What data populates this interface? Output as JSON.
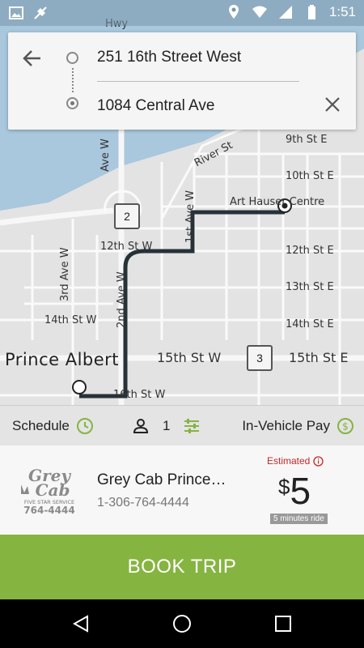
{
  "status_bar": {
    "time": "1:51",
    "icons": [
      "image-icon",
      "no-location-icon",
      "location-icon",
      "wifi-icon",
      "signal-icon",
      "battery-icon"
    ]
  },
  "map": {
    "city_label": "Prince Albert",
    "street_labels": {
      "hwy": "Hwy",
      "ninth": "9th St E",
      "tenth": "10th St E",
      "twelfth_e": "12th St E",
      "thirteenth": "13th St E",
      "fourteenth_e": "14th St E",
      "fifteenth_e": "15th St E",
      "fifteenth_w": "15th St W",
      "twelfth_w": "12th St W",
      "fourteenth_w": "14th St W",
      "sixteenth_w": "16th St W",
      "third_ave": "3rd Ave W",
      "second_ave": "2nd Ave W",
      "first_ave": "1st Ave W",
      "ave_w": "Ave W",
      "river": "River St",
      "poi": "Art Hauser Centre"
    },
    "route_shields": [
      "2",
      "3"
    ]
  },
  "search": {
    "origin": "251 16th Street West",
    "destination": "1084 Central Ave"
  },
  "options": {
    "schedule_label": "Schedule",
    "passenger_count": "1",
    "payment_label": "In-Vehicle Pay"
  },
  "provider": {
    "name": "Grey Cab Prince…",
    "phone": "1-306-764-4444",
    "estimated_label": "Estimated",
    "currency": "$",
    "price": "5",
    "ride_time": "5 minutes ride",
    "logo_text": "Grey Cab FIVE STAR SERVICE 764-4444"
  },
  "book_button": "BOOK TRIP",
  "colors": {
    "accent_green": "#86b441",
    "estimate_red": "#c62828",
    "route": "#263238",
    "water": "#a9c7dd"
  }
}
